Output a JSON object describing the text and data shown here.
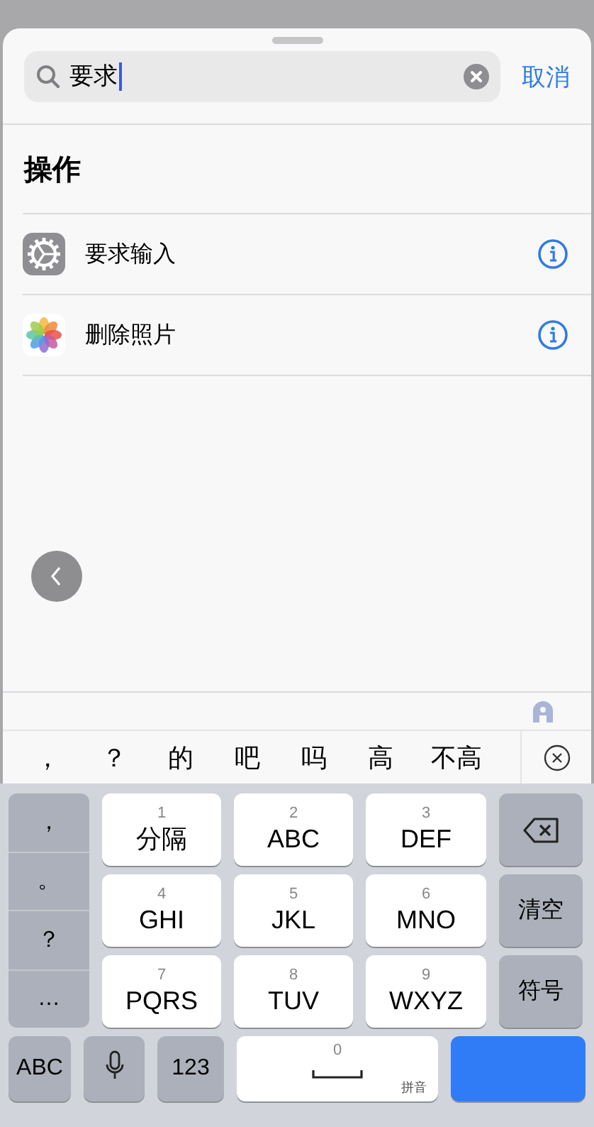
{
  "search": {
    "value": "要求",
    "cancel": "取消"
  },
  "section_title": "操作",
  "actions": [
    {
      "label": "要求输入",
      "kind": "settings"
    },
    {
      "label": "删除照片",
      "kind": "photos"
    }
  ],
  "candidates": [
    "，",
    "？",
    "的",
    "吧",
    "吗",
    "高",
    "不高"
  ],
  "keyboard": {
    "punctuation": [
      "，",
      "。",
      "？",
      "…"
    ],
    "keys": [
      {
        "digit": "1",
        "label": "分隔"
      },
      {
        "digit": "2",
        "label": "ABC"
      },
      {
        "digit": "3",
        "label": "DEF"
      },
      {
        "digit": "4",
        "label": "GHI"
      },
      {
        "digit": "5",
        "label": "JKL"
      },
      {
        "digit": "6",
        "label": "MNO"
      },
      {
        "digit": "7",
        "label": "PQRS"
      },
      {
        "digit": "8",
        "label": "TUV"
      },
      {
        "digit": "9",
        "label": "WXYZ"
      }
    ],
    "side_keys": [
      {
        "kind": "delete"
      },
      {
        "kind": "text",
        "label": "清空"
      },
      {
        "kind": "text",
        "label": "符号"
      }
    ],
    "bottom_keys": [
      {
        "kind": "text",
        "label": "ABC"
      },
      {
        "kind": "mic"
      },
      {
        "kind": "text",
        "label": "123"
      },
      {
        "kind": "space",
        "digit": "0",
        "hint": "拼音"
      },
      {
        "kind": "action"
      }
    ]
  }
}
